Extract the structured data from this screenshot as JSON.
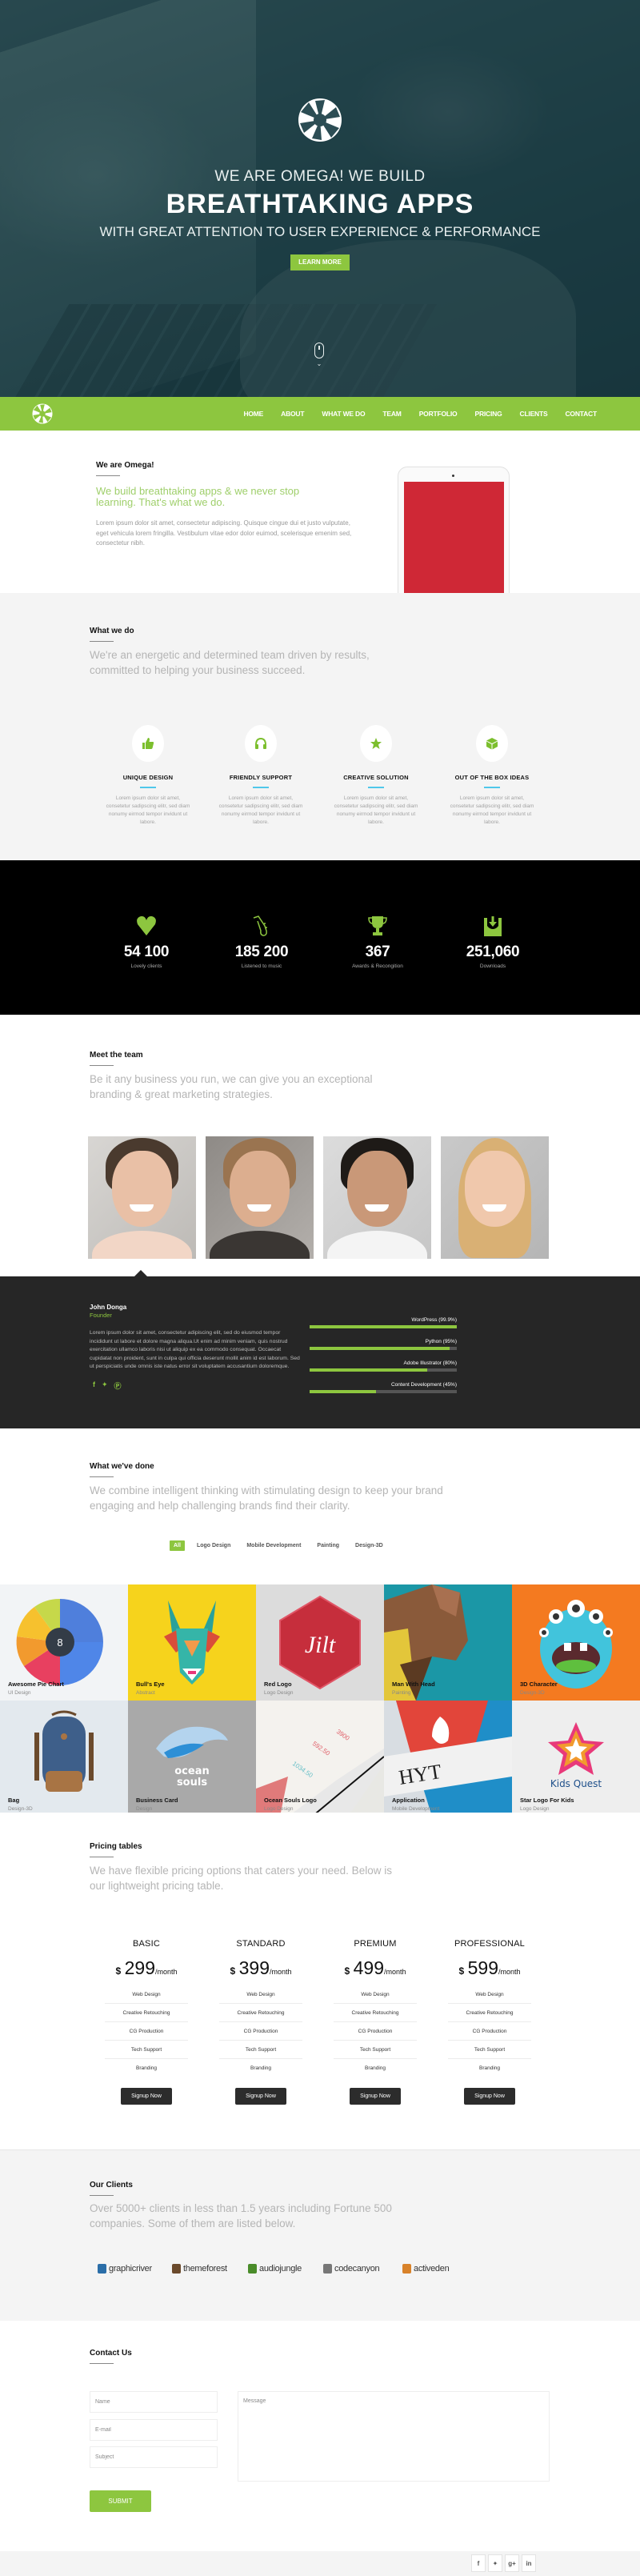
{
  "hero": {
    "kicker": "WE ARE OMEGA! WE BUILD",
    "title": "BREATHTAKING APPS",
    "subtitle": "WITH GREAT ATTENTION TO USER EXPERIENCE & PERFORMANCE",
    "cta_label": "LEARN MORE",
    "logo_icon": "aperture-icon",
    "scroll_icon": "mouse-scroll-icon"
  },
  "nav": {
    "logo_icon": "aperture-icon",
    "items": [
      "HOME",
      "ABOUT",
      "WHAT WE DO",
      "TEAM",
      "PORTFOLIO",
      "PRICING",
      "CLIENTS",
      "CONTACT"
    ]
  },
  "about": {
    "label": "We are Omega!",
    "headline": "We build breathtaking apps & we never stop learning. That's what we do.",
    "body": "Lorem ipsum dolor sit amet, consectetur adipiscing. Quisque cingue dui et justo vulputate, eget vehicula lorem fringilla. Vestibulum vitae edor dolor euimod, scelerisque emenim sed, consectetur nibh."
  },
  "services": {
    "label": "What we do",
    "lead": "We're an energetic and determined team driven by results, committed to helping your business succeed.",
    "items": [
      {
        "icon": "thumbs-up-icon",
        "title": "UNIQUE DESIGN",
        "desc": "Lorem ipsum dolor sit amet, consetetur sadipscing elitr, sed diam nonumy eirmod tempor invidunt ut labore."
      },
      {
        "icon": "headphones-icon",
        "title": "FRIENDLY SUPPORT",
        "desc": "Lorem ipsum dolor sit amet, consetetur sadipscing elitr, sed diam nonumy eirmod tempor invidunt ut labore."
      },
      {
        "icon": "star-icon",
        "title": "CREATIVE SOLUTION",
        "desc": "Lorem ipsum dolor sit amet, consetetur sadipscing elitr, sed diam nonumy eirmod tempor invidunt ut labore."
      },
      {
        "icon": "cube-icon",
        "title": "OUT OF THE BOX IDEAS",
        "desc": "Lorem ipsum dolor sit amet, consetetur sadipscing elitr, sed diam nonumy eirmod tempor invidunt ut labore."
      }
    ]
  },
  "stats": [
    {
      "icon": "heart-icon",
      "value": "54 100",
      "label": "Lovely clients"
    },
    {
      "icon": "saxophone-icon",
      "value": "185 200",
      "label": "Listened to music"
    },
    {
      "icon": "trophy-icon",
      "value": "367",
      "label": "Awards & Recongition"
    },
    {
      "icon": "download-tray-icon",
      "value": "251,060",
      "label": "Downloads"
    }
  ],
  "team": {
    "label": "Meet the team",
    "lead": "Be it any business you run, we can give you an exceptional branding & great marketing strategies.",
    "selected": {
      "name": "John Donga",
      "role": "Founder",
      "bio": "Lorem ipsum dolor sit amet, consectetur adipiscing elit, sed do eiusmod tempor incididunt ut labore et dolore magna aliqua.Ut enim ad minim veniam, quis nostrud exercitation ullamco laboris nisi ut aliquip ex ea commodo consequat. Occaecat cupidatat non proident, sunt in culpa qui officia deserunt mollit anim id est laborum. Sed ut perspiciatis unde omnis iste natus error sit voluptatem accusantium doloremque.",
      "social": [
        {
          "icon": "facebook-icon",
          "glyph": "f"
        },
        {
          "icon": "twitter-icon",
          "glyph": "t"
        },
        {
          "icon": "pinterest-icon",
          "glyph": "p"
        }
      ],
      "skills": [
        {
          "label": "WordPress (99.9%)",
          "percent": 99.9
        },
        {
          "label": "Python (95%)",
          "percent": 95
        },
        {
          "label": "Adobe Illustrator (80%)",
          "percent": 80
        },
        {
          "label": "Content Development (45%)",
          "percent": 45
        }
      ]
    }
  },
  "portfolio": {
    "label": "What we've done",
    "lead": "We combine intelligent thinking with stimulating design to keep your brand engaging and help challenging brands find their clarity.",
    "filters": [
      "All",
      "Logo Design",
      "Mobile Development",
      "Painting",
      "Design-3D"
    ],
    "active_filter": "All",
    "items": [
      {
        "title": "Awesome Pie Chart",
        "category": "UI Design",
        "bg": "#f2f4f6"
      },
      {
        "title": "Bull's Eye",
        "category": "Abstract",
        "bg": "#f6d31c"
      },
      {
        "title": "Red Logo",
        "category": "Logo Design",
        "bg": "#dcdcdc"
      },
      {
        "title": "Man With Head",
        "category": "Painting",
        "bg": "#1b97a6"
      },
      {
        "title": "3D Character",
        "category": "Design-3D",
        "bg": "#f47a20"
      },
      {
        "title": "Bag",
        "category": "Design-3D",
        "bg": "#e3e9ee"
      },
      {
        "title": "Business Card",
        "category": "Design",
        "bg": "#a9a9a9"
      },
      {
        "title": "Ocean Souls Logo",
        "category": "Logo Design",
        "bg": "#e8e8e4"
      },
      {
        "title": "Application",
        "category": "Mobile Development",
        "bg": "#d8dde2"
      },
      {
        "title": "Star Logo For Kids",
        "category": "Logo Design",
        "bg": "#eeeeee"
      }
    ],
    "art_text": {
      "pie_center": "8",
      "jilt": "Jilt",
      "ocean": "ocean",
      "souls": "souls",
      "kids_quest": "Kids Quest",
      "hyt": "HYT"
    }
  },
  "pricing": {
    "label": "Pricing tables",
    "lead": "We have flexible pricing options that caters your need. Below is our lightweight pricing table.",
    "plans": [
      {
        "name": "BASIC",
        "currency": "$",
        "amount": "299",
        "period": "/month",
        "features": [
          "Web Design",
          "Creative Retouching",
          "CG Production",
          "Tech Support",
          "Branding"
        ],
        "cta": "Signup Now"
      },
      {
        "name": "STANDARD",
        "currency": "$",
        "amount": "399",
        "period": "/month",
        "features": [
          "Web Design",
          "Creative Retouching",
          "CG Production",
          "Tech Support",
          "Branding"
        ],
        "cta": "Signup Now"
      },
      {
        "name": "PREMIUM",
        "currency": "$",
        "amount": "499",
        "period": "/month",
        "features": [
          "Web Design",
          "Creative Retouching",
          "CG Production",
          "Tech Support",
          "Branding"
        ],
        "cta": "Signup Now"
      },
      {
        "name": "PROFESSIONAL",
        "currency": "$",
        "amount": "599",
        "period": "/month",
        "features": [
          "Web Design",
          "Creative Retouching",
          "CG Production",
          "Tech Support",
          "Branding"
        ],
        "cta": "Signup Now"
      }
    ]
  },
  "clients": {
    "label": "Our Clients",
    "lead": "Over 5000+ clients in less than 1.5 years including Fortune 500 companies. Some of them are listed below.",
    "logos": [
      {
        "name": "graphicriver",
        "color": "#2b6ea8"
      },
      {
        "name": "themeforest",
        "color": "#6b4a2c"
      },
      {
        "name": "audiojungle",
        "color": "#4a8c2a"
      },
      {
        "name": "codecanyon",
        "color": "#777777"
      },
      {
        "name": "activeden",
        "color": "#d8822a"
      }
    ]
  },
  "contact": {
    "label": "Contact Us",
    "name_placeholder": "Name",
    "email_placeholder": "E-mail",
    "subject_placeholder": "Subject",
    "message_placeholder": "Message",
    "submit_label": "SUBMIT"
  },
  "footer": {
    "social": [
      {
        "icon": "facebook-icon",
        "glyph": "f"
      },
      {
        "icon": "twitter-icon",
        "glyph": "t"
      },
      {
        "icon": "google-plus-icon",
        "glyph": "g+"
      },
      {
        "icon": "linkedin-icon",
        "glyph": "in"
      }
    ]
  },
  "colors": {
    "accent": "#8dc63f",
    "dark": "#262626",
    "service_underline": "#4fc7ea",
    "tablet_screen": "#cf2836"
  }
}
